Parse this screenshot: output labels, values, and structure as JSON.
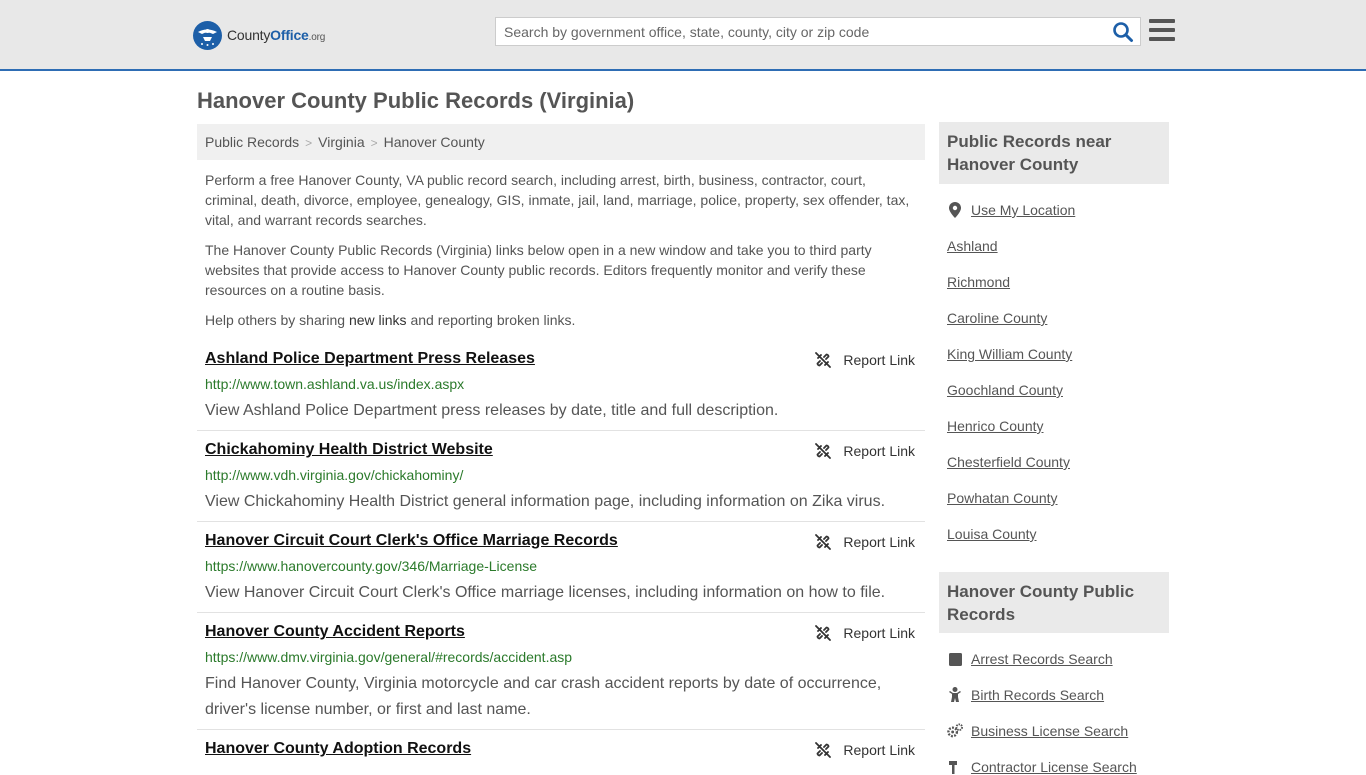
{
  "header": {
    "logo_prefix": "County",
    "logo_bold": "Office",
    "logo_suffix": ".org",
    "search_placeholder": "Search by government office, state, county, city or zip code",
    "brand_color": "#1d5fa8"
  },
  "page_title": "Hanover County Public Records (Virginia)",
  "breadcrumb": [
    "Public Records",
    "Virginia",
    "Hanover County"
  ],
  "intro": {
    "p1": "Perform a free Hanover County, VA public record search, including arrest, birth, business, contractor, court, criminal, death, divorce, employee, genealogy, GIS, inmate, jail, land, marriage, police, property, sex offender, tax, vital, and warrant records searches.",
    "p2": "The Hanover County Public Records (Virginia) links below open in a new window and take you to third party websites that provide access to Hanover County public records. Editors frequently monitor and verify these resources on a routine basis.",
    "p3_before": "Help others by sharing ",
    "p3_link": "new links",
    "p3_after": " and reporting broken links."
  },
  "report_label": "Report Link",
  "records": [
    {
      "title": "Ashland Police Department Press Releases",
      "url": "http://www.town.ashland.va.us/index.aspx",
      "desc": "View Ashland Police Department press releases by date, title and full description."
    },
    {
      "title": "Chickahominy Health District Website",
      "url": "http://www.vdh.virginia.gov/chickahominy/",
      "desc": "View Chickahominy Health District general information page, including information on Zika virus."
    },
    {
      "title": "Hanover Circuit Court Clerk's Office Marriage Records",
      "url": "https://www.hanovercounty.gov/346/Marriage-License",
      "desc": "View Hanover Circuit Court Clerk's Office marriage licenses, including information on how to file."
    },
    {
      "title": "Hanover County Accident Reports",
      "url": "https://www.dmv.virginia.gov/general/#records/accident.asp",
      "desc": "Find Hanover County, Virginia motorcycle and car crash accident reports by date of occurrence, driver's license number, or first and last name."
    },
    {
      "title": "Hanover County Adoption Records",
      "url": "",
      "desc": ""
    }
  ],
  "sidebar": {
    "near_heading": "Public Records near Hanover County",
    "use_location": "Use My Location",
    "near_links": [
      "Ashland",
      "Richmond",
      "Caroline County",
      "King William County",
      "Goochland County",
      "Henrico County",
      "Chesterfield County",
      "Powhatan County",
      "Louisa County"
    ],
    "records_heading": "Hanover County Public Records",
    "record_links": [
      {
        "label": "Arrest Records Search",
        "icon": "square-icon"
      },
      {
        "label": "Birth Records Search",
        "icon": "baby-icon"
      },
      {
        "label": "Business License Search",
        "icon": "gears-icon"
      },
      {
        "label": "Contractor License Search",
        "icon": "hammer-icon"
      }
    ]
  }
}
